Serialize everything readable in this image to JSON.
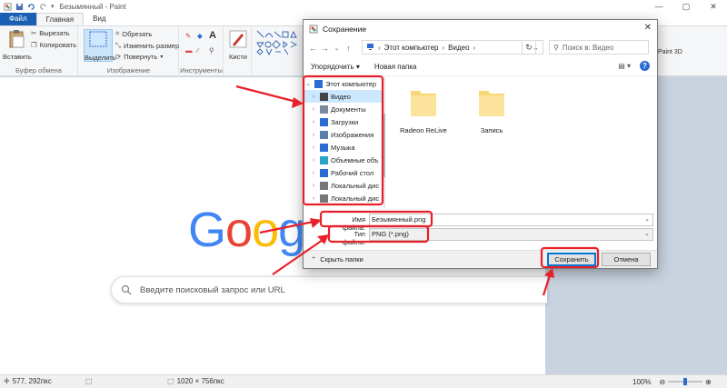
{
  "paint": {
    "title": "Безымянный - Paint",
    "tabs": [
      "Файл",
      "Главная",
      "Вид"
    ],
    "ribbon": {
      "clipboard": {
        "paste": "Вставить",
        "cut": "Вырезать",
        "copy": "Копировать",
        "group": "Буфер обмена"
      },
      "image": {
        "select": "Выделить",
        "crop": "Обрезать",
        "resize": "Изменить размер",
        "rotate": "Повернуть",
        "group": "Изображение"
      },
      "tools": {
        "group": "Инструменты"
      },
      "brushes": {
        "label": "Кисти"
      },
      "paint3d": "Paint 3D"
    },
    "status": {
      "coords": "577, 292пкс",
      "size": "1020 × 756пкс",
      "zoom": "100%"
    }
  },
  "page": {
    "logo": [
      "G",
      "o",
      "o",
      "g"
    ],
    "search_placeholder": "Введите поисковый запрос или URL"
  },
  "dialog": {
    "title": "Сохранение",
    "address": {
      "root": "Этот компьютер",
      "folder": "Видео"
    },
    "search_placeholder": "Поиск в: Видео",
    "toolbar": {
      "organize": "Упорядочить",
      "new_folder": "Новая папка"
    },
    "tree": [
      {
        "label": "Этот компьютер",
        "icon": "computer-icon",
        "level": 0
      },
      {
        "label": "Видео",
        "icon": "video-icon",
        "level": 1,
        "selected": true
      },
      {
        "label": "Документы",
        "icon": "documents-icon",
        "level": 1
      },
      {
        "label": "Загрузки",
        "icon": "downloads-icon",
        "level": 1
      },
      {
        "label": "Изображения",
        "icon": "images-icon",
        "level": 1
      },
      {
        "label": "Музыка",
        "icon": "music-icon",
        "level": 1
      },
      {
        "label": "Объемные объ",
        "icon": "3d-objects-icon",
        "level": 1
      },
      {
        "label": "Рабочий стол",
        "icon": "desktop-icon",
        "level": 1
      },
      {
        "label": "Локальный дис",
        "icon": "disk-icon",
        "level": 1
      },
      {
        "label": "Локальный дис",
        "icon": "disk-icon",
        "level": 1
      }
    ],
    "folders": [
      "Radeon ReLive",
      "Запись"
    ],
    "filename_label": "Имя файла:",
    "filename_value": "Безымянный.png",
    "filetype_label": "Тип файла:",
    "filetype_value": "PNG (*.png)",
    "hide_folders": "Скрыть папки",
    "save": "Сохранить",
    "cancel": "Отмена"
  },
  "colors": {
    "accent": "#0078d7",
    "annotation": "#e8202a",
    "folder": "#f8d775"
  }
}
